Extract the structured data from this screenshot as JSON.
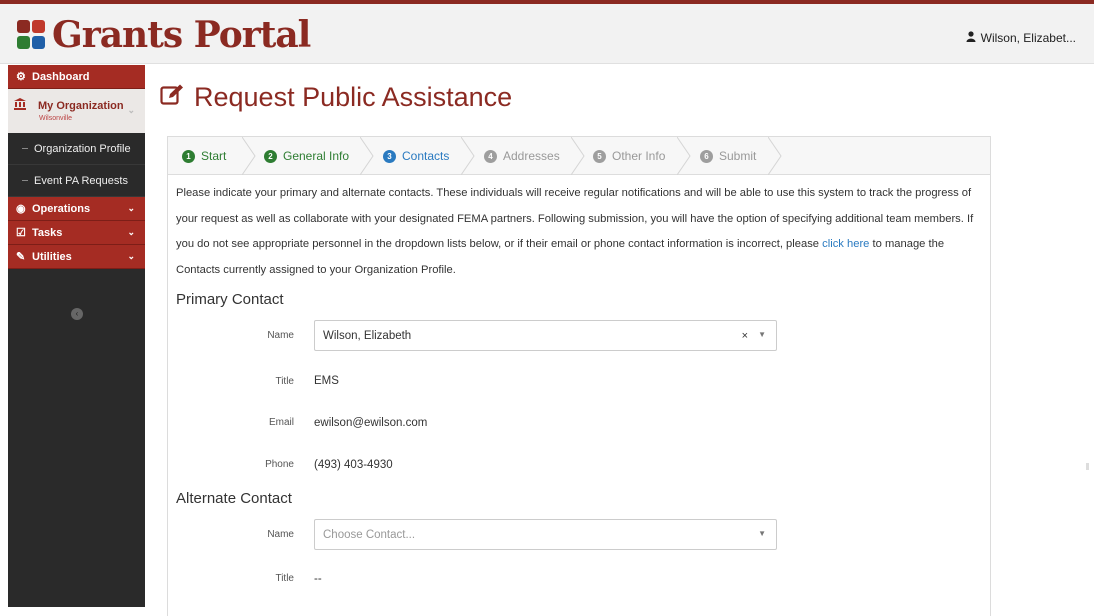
{
  "app": {
    "title": "Grants Portal",
    "user_name": "Wilson, Elizabet..."
  },
  "sidebar": {
    "dashboard": "Dashboard",
    "my_org": "My Organization",
    "org_name": "Wilsonville",
    "org_profile": "Organization Profile",
    "event_pa": "Event PA Requests",
    "operations": "Operations",
    "tasks": "Tasks",
    "utilities": "Utilities"
  },
  "page": {
    "title": "Request Public Assistance"
  },
  "steps": [
    {
      "num": "1",
      "label": "Start"
    },
    {
      "num": "2",
      "label": "General Info"
    },
    {
      "num": "3",
      "label": "Contacts"
    },
    {
      "num": "4",
      "label": "Addresses"
    },
    {
      "num": "5",
      "label": "Other Info"
    },
    {
      "num": "6",
      "label": "Submit"
    }
  ],
  "intro": {
    "text_before": "Please indicate your primary and alternate contacts. These individuals will receive regular notifications and will be able to use this system to track the progress of your request as well as collaborate with your designated FEMA partners. Following submission, you will have the option of specifying additional team members. If you do not see appropriate personnel in the dropdown lists below, or if their email or phone contact information is incorrect, please ",
    "link": "click here",
    "text_after": " to manage the Contacts currently assigned to your Organization Profile."
  },
  "primary": {
    "heading": "Primary Contact",
    "name_label": "Name",
    "name_value": "Wilson, Elizabeth",
    "title_label": "Title",
    "title_value": "EMS",
    "email_label": "Email",
    "email_value": "ewilson@ewilson.com",
    "phone_label": "Phone",
    "phone_value": "(493) 403-4930"
  },
  "alternate": {
    "heading": "Alternate Contact",
    "name_label": "Name",
    "name_placeholder": "Choose Contact...",
    "title_label": "Title",
    "title_value": "--"
  },
  "colors": {
    "brand": "#8b2a22",
    "sidebar_red": "#a52c23",
    "step_done": "#2e7d32",
    "step_active": "#2a7ac0",
    "step_pending": "#9e9e9e"
  },
  "icons": {
    "title_icon": "edit-icon",
    "user_icon": "user-icon"
  }
}
